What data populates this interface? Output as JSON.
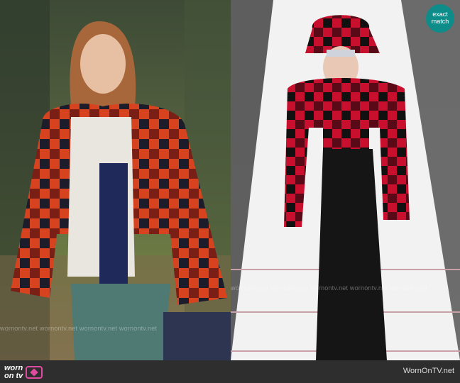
{
  "badge": {
    "line1": "exact",
    "line2": "match"
  },
  "watermarks": {
    "left_row": "wornontv.net   wornontv.net   wornontv.net   wornontv.net",
    "right_row": "wornontv.net   wornontv.net   wornontv.net   wornontv.net   wornontv.net"
  },
  "footer": {
    "logo_line1": "worn",
    "logo_line2": "on tv",
    "site": "WornOnTV.net"
  },
  "colors": {
    "footer_bg": "#2e2e2e",
    "badge_bg": "#0e8c8a",
    "logo_accent": "#e04aa0",
    "plaid_red": "#c8102e",
    "plaid_black": "#111111"
  }
}
